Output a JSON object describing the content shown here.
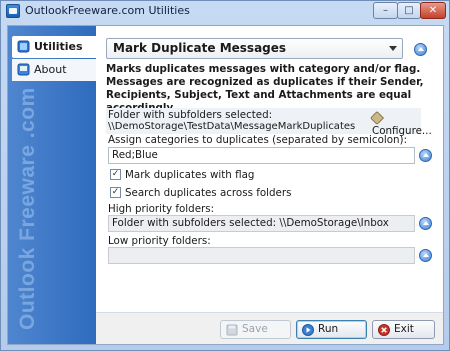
{
  "window": {
    "title": "OutlookFreeware.com Utilities"
  },
  "sidebar": {
    "items": [
      {
        "label": "Utilities",
        "active": true
      },
      {
        "label": "About",
        "active": false
      }
    ],
    "brand": "Outlook Freeware .com"
  },
  "main": {
    "utility_selected": "Mark Duplicate Messages",
    "description": "Marks duplicates messages with category and/or flag. Messages are recognized as duplicates if their Sender, Recipients, Subject, Text and Attachments are equal accordingly.",
    "folder_label": "Folder with subfolders selected:",
    "folder_path": "\\\\DemoStorage\\TestData\\MessageMarkDuplicates",
    "configure_label": "Configure...",
    "categories_label": "Assign categories to duplicates (separated by semicolon):",
    "categories_value": "Red;Blue",
    "mark_flag": {
      "label": "Mark duplicates with flag",
      "checked": true
    },
    "search_across": {
      "label": "Search duplicates across folders",
      "checked": true
    },
    "high_priority_label": "High priority folders:",
    "high_priority_value": "Folder with subfolders selected: \\\\DemoStorage\\Inbox",
    "low_priority_label": "Low priority folders:",
    "low_priority_value": ""
  },
  "footer": {
    "save_label": "Save",
    "run_label": "Run",
    "exit_label": "Exit"
  },
  "colors": {
    "sidebar": "#2f6bbd",
    "accent": "#3d7fd1",
    "exit_icon": "#c8342a"
  }
}
